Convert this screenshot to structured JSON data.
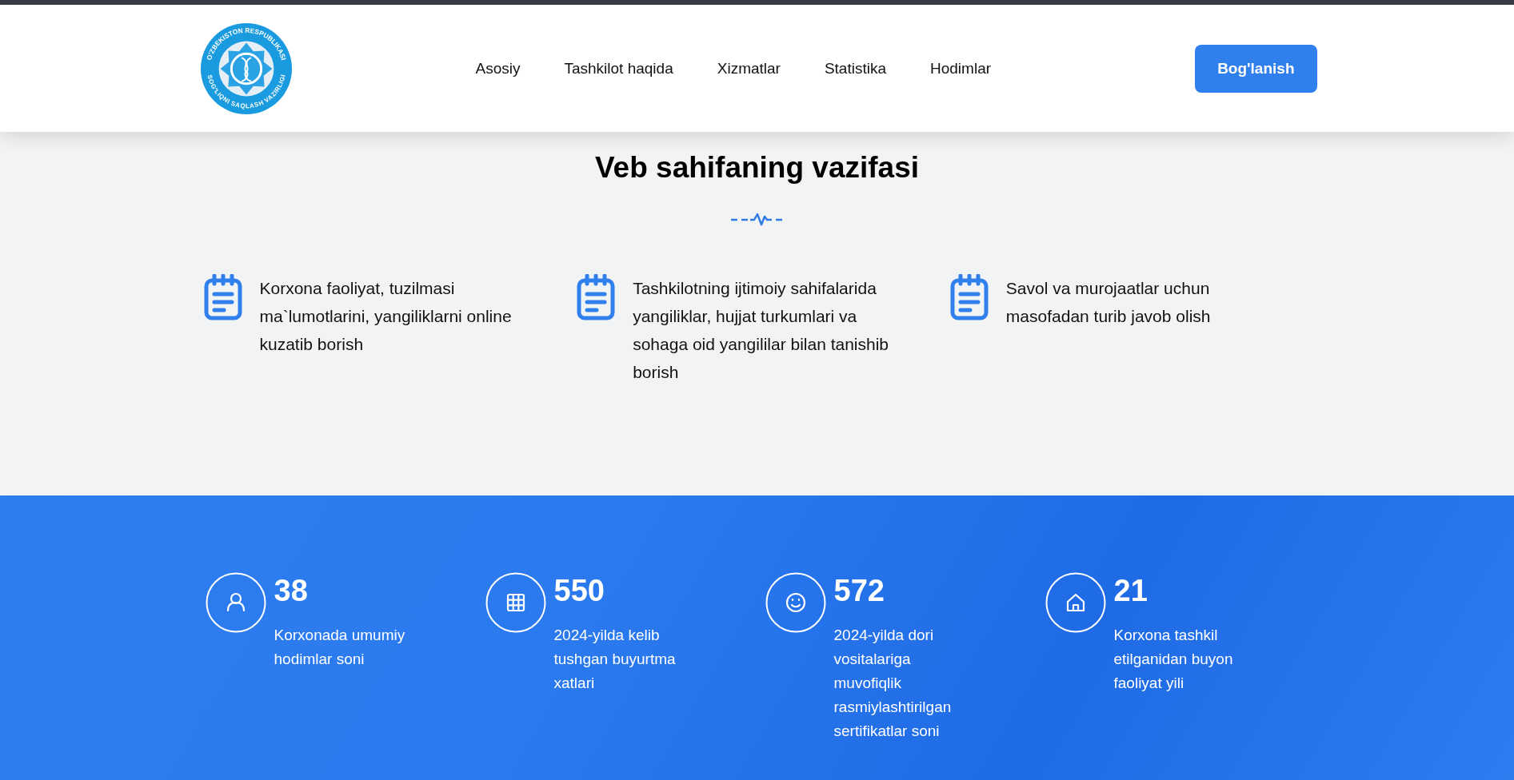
{
  "header": {
    "logo": {
      "top_text": "O'ZBEKISTON RESPUBLIKASI",
      "bottom_text": "SOG'LIQNI SAQLASH VAZIRLIGI"
    },
    "nav": [
      {
        "label": "Asosiy"
      },
      {
        "label": "Tashkilot haqida"
      },
      {
        "label": "Xizmatlar"
      },
      {
        "label": "Statistika"
      },
      {
        "label": "Hodimlar"
      }
    ],
    "contact_button": "Bog'lanish"
  },
  "tasks": {
    "title": "Veb sahifaning vazifasi",
    "items": [
      {
        "text": "Korxona faoliyat, tuzilmasi ma`lumotlarini, yangiliklarni online kuzatib borish"
      },
      {
        "text": "Tashkilotning ijtimoiy sahifalarida yangiliklar, hujjat turkumlari va sohaga oid yangililar bilan tanishib borish"
      },
      {
        "text": "Savol va murojaatlar uchun masofadan turib javob olish"
      }
    ]
  },
  "stats": [
    {
      "kind": "person",
      "value": "38",
      "label": "Korxonada umumiy hodimlar soni"
    },
    {
      "kind": "grid",
      "value": "550",
      "label": "2024-yilda kelib tushgan buyurtma xatlari"
    },
    {
      "kind": "smile",
      "value": "572",
      "label": "2024-yilda dori vositalariga muvofiqlik rasmiylashtirilgan sertifikatlar soni"
    },
    {
      "kind": "home",
      "value": "21",
      "label": "Korxona tashkil etilganidan buyon faoliyat yili"
    }
  ]
}
